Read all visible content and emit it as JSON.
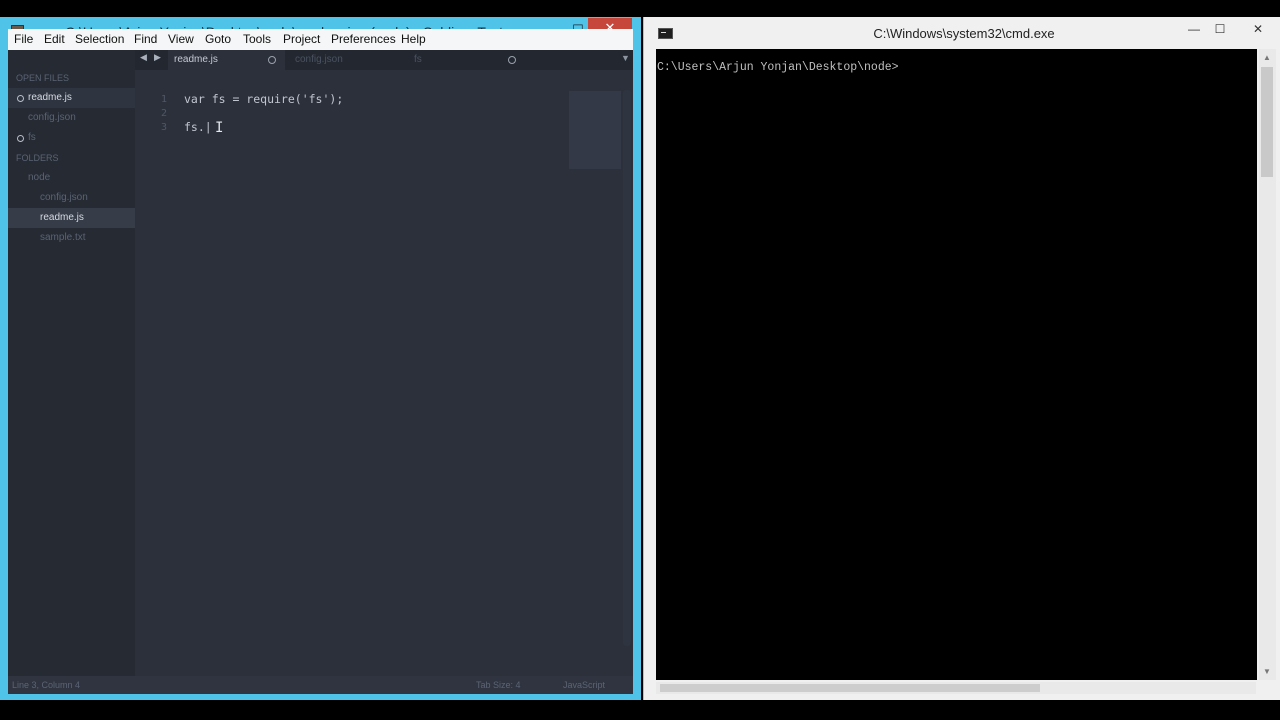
{
  "sublime": {
    "title": "C:\\Users\\Arjun Yonjan\\Desktop\\node\\readme.js • (node) - Sublime Text",
    "controls": {
      "minimize": "—",
      "maximize": "☐",
      "close": "✕"
    },
    "menu": [
      "File",
      "Edit",
      "Selection",
      "Find",
      "View",
      "Goto",
      "Tools",
      "Project",
      "Preferences",
      "Help"
    ],
    "sidebar": {
      "open_files_header": "OPEN FILES",
      "open_files": [
        "readme.js",
        "config.json",
        "fs"
      ],
      "folders_header": "FOLDERS",
      "folder": "node",
      "folder_files": [
        "config.json",
        "readme.js",
        "sample.txt"
      ]
    },
    "tabs": [
      "readme.js",
      "config.json",
      "fs"
    ],
    "tab_nav": {
      "back": "◀",
      "forward": "▶",
      "dropdown": "▼"
    },
    "gutter": [
      "1",
      "2",
      "3"
    ],
    "code": [
      "var fs = require('fs');",
      "",
      "fs.|"
    ],
    "ibeam": "I",
    "status": {
      "position": "Line 3, Column 4",
      "tab_size": "Tab Size: 4",
      "syntax": "JavaScript"
    }
  },
  "cmd": {
    "title": "C:\\Windows\\system32\\cmd.exe",
    "controls": {
      "minimize": "—",
      "maximize": "☐",
      "close": "✕"
    },
    "prompt": "C:\\Users\\Arjun Yonjan\\Desktop\\node>",
    "scroll_arrow_up": "▲",
    "scroll_arrow_down": "▼"
  },
  "colors": {
    "sublime_frame": "#4fc3e8",
    "editor_bg": "#2b303b",
    "sidebar_bg": "#252a33",
    "close_red": "#c7463c",
    "console_bg": "#000000"
  }
}
